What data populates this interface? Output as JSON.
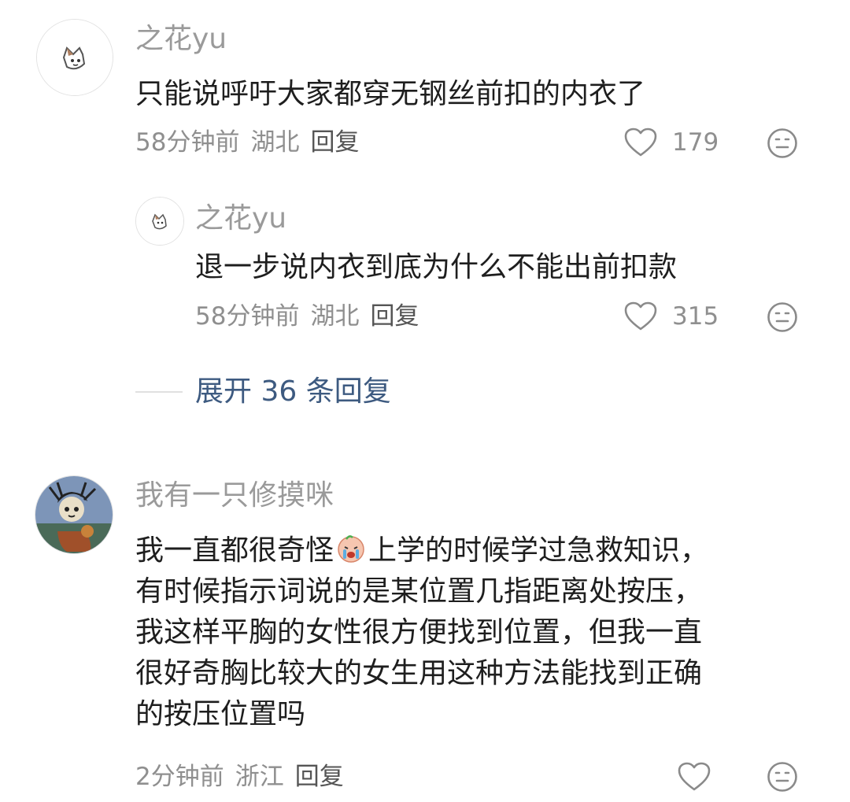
{
  "comments": [
    {
      "username": "之花yu",
      "lines": [
        "只能说呼吁大家都穿无钢丝前扣的内衣了"
      ],
      "time": "58分钟前",
      "location": "湖北",
      "reply_label": "回复",
      "likes": "179"
    },
    {
      "username": "我有一只修摸咪",
      "line1_before": "我一直都很奇怪",
      "line1_after": "上学的时候学过急救知识，",
      "lines_rest": [
        "有时候指示词说的是某位置几指距离处按压，",
        "我这样平胸的女性很方便找到位置，但我一直",
        "很好奇胸比较大的女生用这种方法能找到正确",
        "的按压位置吗"
      ],
      "time": "2分钟前",
      "location": "浙江",
      "reply_label": "回复",
      "likes": ""
    }
  ],
  "reply": {
    "username": "之花yu",
    "lines": [
      "退一步说内衣到底为什么不能出前扣款"
    ],
    "time": "58分钟前",
    "location": "湖北",
    "reply_label": "回复",
    "likes": "315"
  },
  "expand_replies": "展开 36 条回复",
  "icons": {
    "like": "heart-outline-icon",
    "reaction": "neutral-face-icon",
    "inline_emoji": "crying-face-emoji"
  },
  "colors": {
    "username": "#9a9a9a",
    "content": "#1e1e1e",
    "meta": "#8f8f8f",
    "expand_link": "#3d5a80"
  }
}
